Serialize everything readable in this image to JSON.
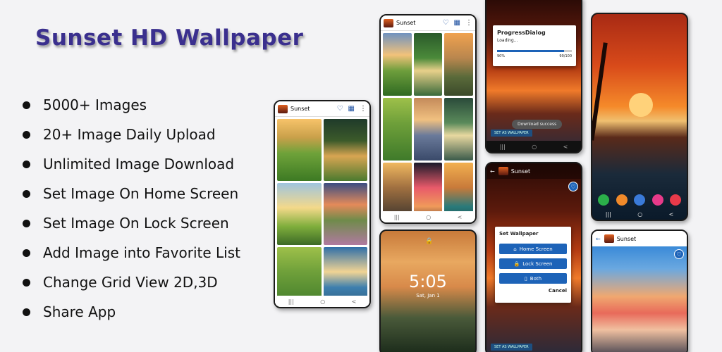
{
  "title": "Sunset HD Wallpaper",
  "features": [
    "5000+ Images",
    "20+ Image Daily Upload",
    "Unlimited Image Download",
    "Set Image On Home Screen",
    "Set Image On Lock Screen",
    "Add Image into Favorite List",
    "Change Grid View 2D,3D",
    "Share App"
  ],
  "app": {
    "name": "Sunset"
  },
  "progress_dialog": {
    "title": "ProgressDialog",
    "message": "Loading...",
    "percent": "90%",
    "count": "90/100",
    "progress": 0.9
  },
  "toast": "Download success",
  "set_as_wallpaper": "SET AS WALLPAPER",
  "lock_screen": {
    "time": "5:05",
    "date": "Sat, Jan 1"
  },
  "set_wallpaper_dialog": {
    "title": "Set Wallpaper",
    "options": [
      "Home Screen",
      "Lock Screen",
      "Both"
    ],
    "cancel": "Cancel"
  },
  "nav": {
    "recent": "|||",
    "home": "○",
    "back": "<"
  },
  "colors": {
    "title": "#3a2f8e",
    "accent": "#1d63b8",
    "bar": "#1d4f80"
  }
}
